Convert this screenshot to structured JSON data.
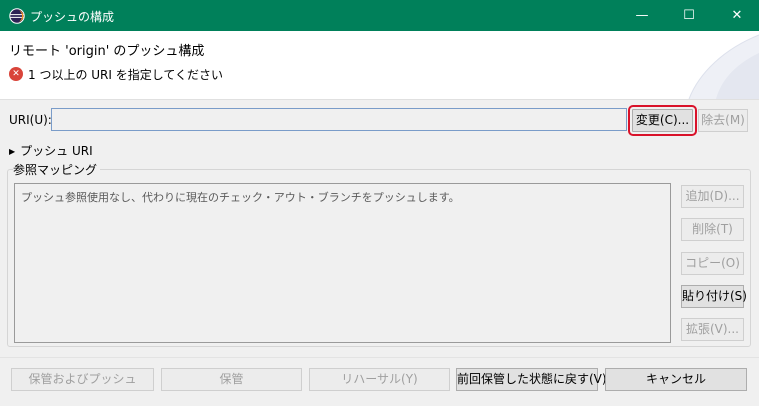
{
  "window": {
    "title": "プッシュの構成",
    "minimize_glyph": "—",
    "maximize_glyph": "☐",
    "close_glyph": "✕"
  },
  "header": {
    "heading": "リモート 'origin' のプッシュ構成",
    "error_icon_glyph": "✕",
    "error_message": "1 つ以上の URI を指定してください"
  },
  "uri": {
    "label": "URI(U):",
    "value": "",
    "change_button": "変更(C)...",
    "remove_button": "除去(M)"
  },
  "push_uri": {
    "toggle_glyph": "▶",
    "label": "プッシュ URI"
  },
  "ref_mapping": {
    "group_label": "参照マッピング",
    "list_item": "プッシュ参照使用なし、代わりに現在のチェック・アウト・ブランチをプッシュします。",
    "add_button": "追加(D)...",
    "delete_button": "削除(T)",
    "copy_button": "コピー(O)",
    "paste_button": "貼り付け(S)",
    "expand_button": "拡張(V)..."
  },
  "footer": {
    "save_and_push": "保管およびプッシュ",
    "save": "保管",
    "rehearsal": "リハーサル(Y)",
    "revert": "前回保管した状態に戻す(V)",
    "cancel": "キャンセル"
  },
  "colors": {
    "titlebar": "#00805a",
    "error": "#d9443a",
    "highlight": "#d9122a"
  }
}
